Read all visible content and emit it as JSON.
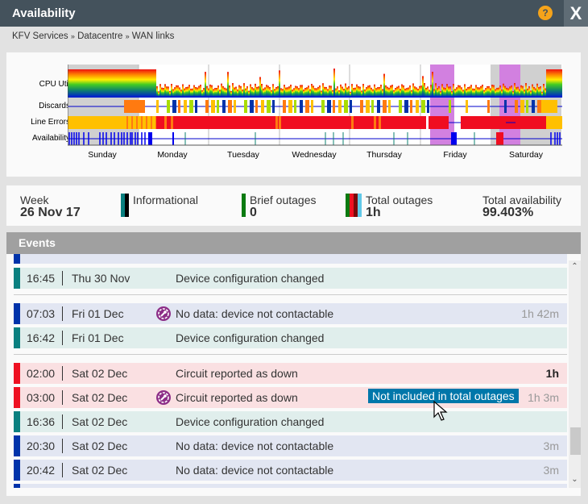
{
  "window": {
    "title": "Availability",
    "help_icon": "?",
    "close_label": "X"
  },
  "breadcrumb": [
    "KFV Services",
    "»",
    "Datacentre",
    "»",
    "WAN links"
  ],
  "chart": {
    "row_labels": [
      "CPU Util",
      "Discards",
      "Line Errors",
      "Availability"
    ],
    "day_labels": [
      "Sunday",
      "Monday",
      "Tuesday",
      "Wednesday",
      "Thursday",
      "Friday",
      "Saturday"
    ],
    "colors": {
      "shaded": "#d0d0d0",
      "highlight": "#d280e0",
      "line_red": "#f00d20",
      "line_amber": "#ffc000",
      "discard_orange": "#ff7a10",
      "availability_blue": "#0000ee",
      "availability_teal": "#0e8070"
    }
  },
  "summary": {
    "week_label": "Week",
    "week_value": "26 Nov 17",
    "informational_label": "Informational",
    "brief_label": "Brief outages",
    "brief_value": "0",
    "total_label": "Total outages",
    "total_value": "1h",
    "availability_label": "Total availability",
    "availability_value": "99.403%"
  },
  "events": {
    "header": "Events",
    "tooltip": "Not included in total outages",
    "rows": [
      {
        "time": "16:45",
        "date": "Thu 30 Nov",
        "desc": "Device configuration changed",
        "duration": "",
        "type": "info",
        "icon": false
      },
      {
        "time": "07:03",
        "date": "Fri 01 Dec",
        "desc": "No data: device not contactable",
        "duration": "1h 42m",
        "type": "nodata",
        "icon": true
      },
      {
        "time": "16:42",
        "date": "Fri 01 Dec",
        "desc": "Device configuration changed",
        "duration": "",
        "type": "info",
        "icon": false
      },
      {
        "time": "02:00",
        "date": "Sat 02 Dec",
        "desc": "Circuit reported as down",
        "duration": "1h",
        "type": "down",
        "icon": false
      },
      {
        "time": "03:00",
        "date": "Sat 02 Dec",
        "desc": "Circuit reported as down",
        "duration": "1h 3m",
        "type": "down",
        "icon": true
      },
      {
        "time": "16:36",
        "date": "Sat 02 Dec",
        "desc": "Device configuration changed",
        "duration": "",
        "type": "info",
        "icon": false
      },
      {
        "time": "20:30",
        "date": "Sat 02 Dec",
        "desc": "No data: device not contactable",
        "duration": "3m",
        "type": "nodata",
        "icon": false
      },
      {
        "time": "20:42",
        "date": "Sat 02 Dec",
        "desc": "No data: device not contactable",
        "duration": "3m",
        "type": "nodata",
        "icon": false
      }
    ]
  },
  "theme": {
    "info_bar": "#0a8080",
    "info_bg": "#e0eeec",
    "nodata_bar": "#0033aa",
    "nodata_bg": "#e2e6f2",
    "down_bar": "#ee1122",
    "down_bg": "#fae0e2"
  }
}
